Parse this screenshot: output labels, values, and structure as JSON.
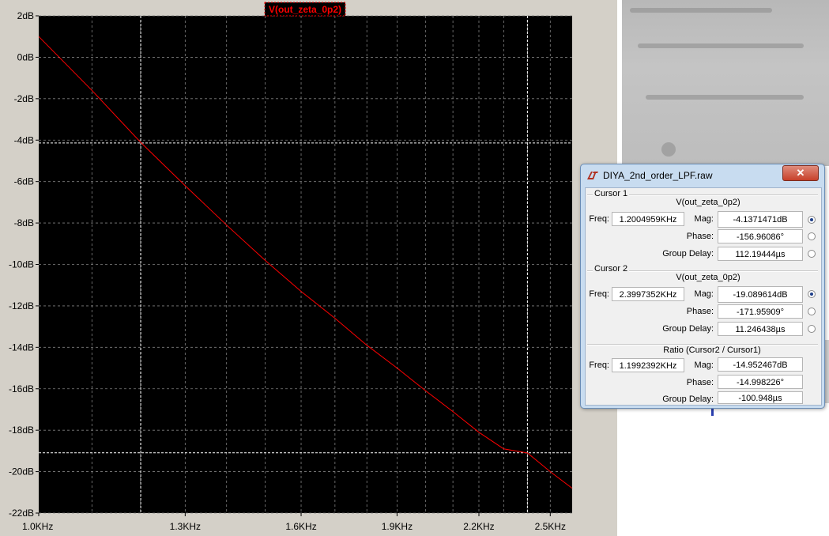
{
  "plot": {
    "trace_label": "V(out_zeta_0p2)",
    "trace_color": "#ff0000",
    "y_ticks": [
      "2dB",
      "0dB",
      "-2dB",
      "-4dB",
      "-6dB",
      "-8dB",
      "-10dB",
      "-12dB",
      "-14dB",
      "-16dB",
      "-18dB",
      "-20dB",
      "-22dB"
    ],
    "x_ticks": [
      "1.0KHz",
      "1.3KHz",
      "1.6KHz",
      "1.9KHz",
      "2.2KHz",
      "2.5KHz"
    ]
  },
  "chart_data": {
    "type": "line",
    "title": "V(out_zeta_0p2)",
    "x_unit": "KHz",
    "y_unit": "dB",
    "xlim": [
      1.0,
      2.6
    ],
    "ylim": [
      -22,
      2
    ],
    "x_tick_values": [
      1.0,
      1.3,
      1.6,
      1.9,
      2.2,
      2.5
    ],
    "y_tick_values": [
      2,
      0,
      -2,
      -4,
      -6,
      -8,
      -10,
      -12,
      -14,
      -16,
      -18,
      -20,
      -22
    ],
    "grid": true,
    "series": [
      {
        "name": "V(out_zeta_0p2)",
        "x": [
          1.0,
          1.1,
          1.2,
          1.3,
          1.4,
          1.5,
          1.6,
          1.7,
          1.8,
          1.9,
          2.0,
          2.1,
          2.2,
          2.3,
          2.4,
          2.5,
          2.6
        ],
        "y": [
          1.0,
          -1.6,
          -4.1,
          -6.2,
          -8.1,
          -9.8,
          -11.3,
          -12.6,
          -13.9,
          -15.0,
          -16.1,
          -17.1,
          -18.1,
          -18.9,
          -19.1,
          -20.0,
          -20.8
        ]
      }
    ],
    "cursors": [
      {
        "name": "Cursor 1",
        "x": 1.2004959,
        "y": -4.1371471
      },
      {
        "name": "Cursor 2",
        "x": 2.3997352,
        "y": -19.089614
      }
    ]
  },
  "dialog": {
    "title": "DIYA_2nd_order_LPF.raw",
    "close_label": "✕",
    "cursor1": {
      "title": "Cursor 1",
      "trace": "V(out_zeta_0p2)",
      "freq_label": "Freq:",
      "freq": "1.2004959KHz",
      "mag_label": "Mag:",
      "mag": "-4.1371471dB",
      "phase_label": "Phase:",
      "phase": "-156.96086°",
      "gd_label": "Group Delay:",
      "gd": "112.19444µs",
      "selected": "mag"
    },
    "cursor2": {
      "title": "Cursor 2",
      "trace": "V(out_zeta_0p2)",
      "freq_label": "Freq:",
      "freq": "2.3997352KHz",
      "mag_label": "Mag:",
      "mag": "-19.089614dB",
      "phase_label": "Phase:",
      "phase": "-171.95909°",
      "gd_label": "Group Delay:",
      "gd": "11.246438µs",
      "selected": "mag"
    },
    "ratio": {
      "title": "Ratio (Cursor2 / Cursor1)",
      "freq_label": "Freq:",
      "freq": "1.1992392KHz",
      "mag_label": "Mag:",
      "mag": "-14.952467dB",
      "phase_label": "Phase:",
      "phase": "-14.998226°",
      "gd_label": "Group Delay:",
      "gd": "-100.948µs"
    }
  }
}
